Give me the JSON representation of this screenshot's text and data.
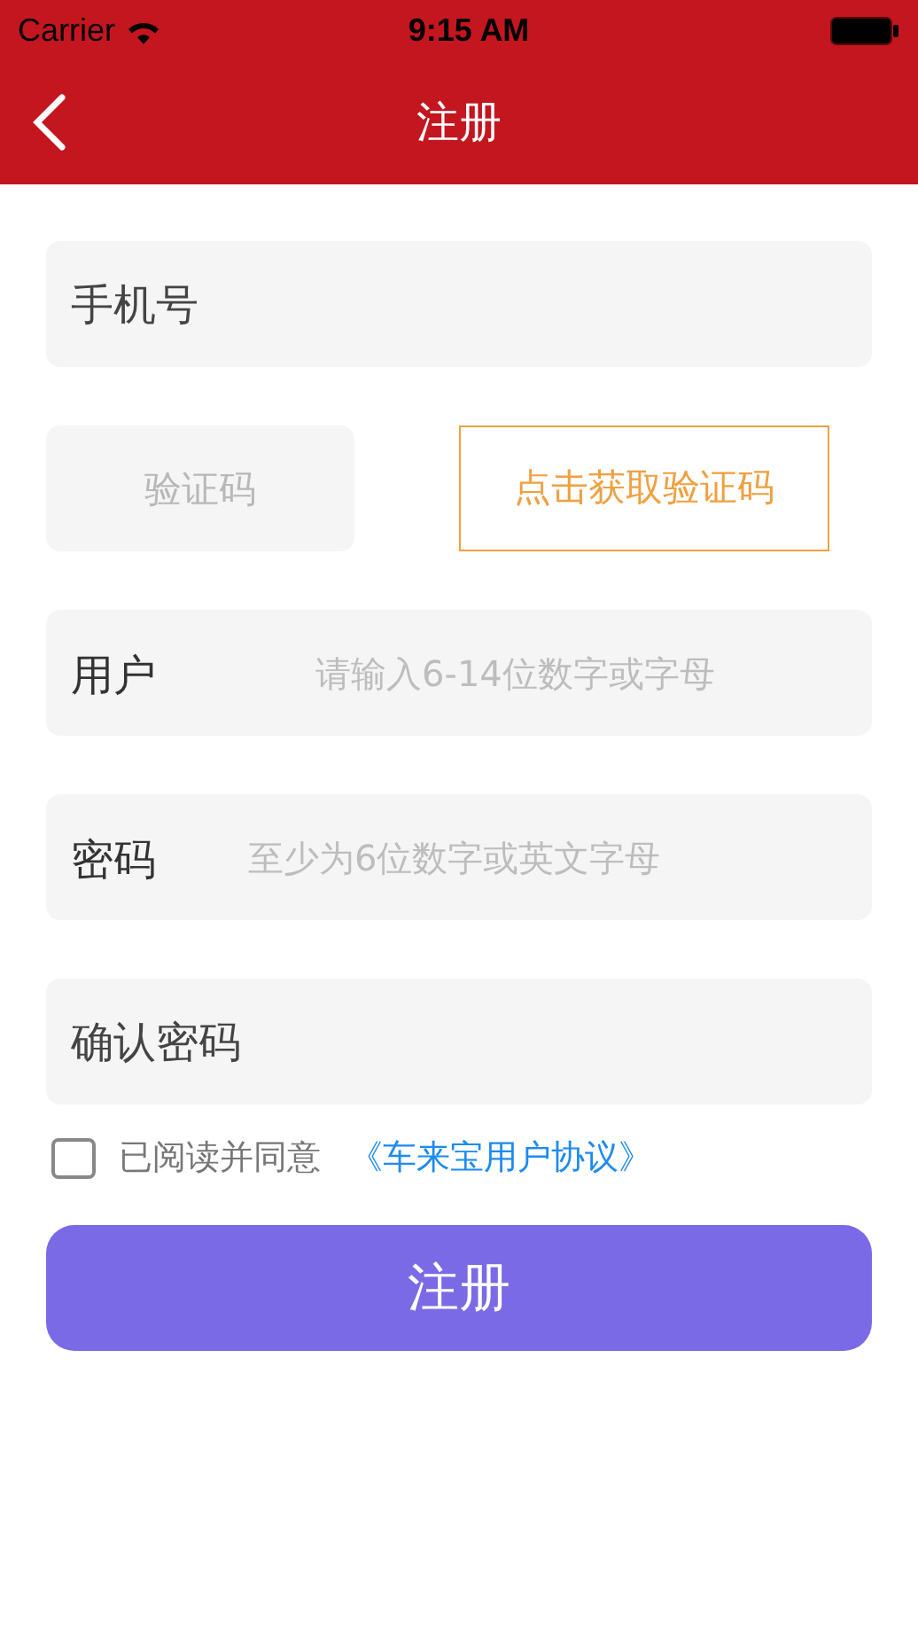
{
  "status_bar": {
    "carrier": "Carrier",
    "time": "9:15 AM"
  },
  "nav": {
    "title": "注册"
  },
  "fields": [
    {
      "kind": "label",
      "label": "手机号"
    },
    {
      "kind": "code",
      "placeholder": "验证码",
      "button": "点击获取验证码"
    },
    {
      "kind": "labeled",
      "label": "用户",
      "placeholder": "请输入6-14位数字或字母"
    },
    {
      "kind": "labeled",
      "label": "密码",
      "placeholder": "至少为6位数字或英文字母"
    },
    {
      "kind": "label",
      "label": "确认密码"
    }
  ],
  "agreement": {
    "checked": false,
    "text": "已阅读并同意",
    "link": "《车来宝用户协议》"
  },
  "submit": {
    "label": "注册"
  }
}
